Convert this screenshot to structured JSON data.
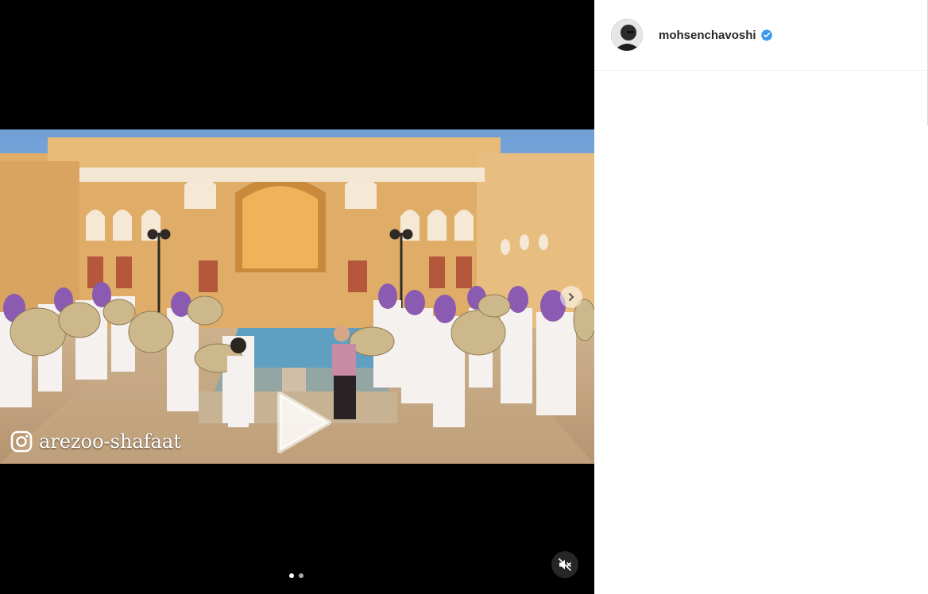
{
  "post": {
    "username": "mohsenchavoshi",
    "verified": true,
    "watermark_text": "arezoo-shafaat",
    "carousel": {
      "count": 2,
      "active": 0
    },
    "muted": true
  },
  "colors": {
    "media_bg": "#000000",
    "verified_blue": "#3897f0",
    "facade": "#e3b46b",
    "scarf_purple": "#8a5bb0",
    "sky": "#7fa9d8"
  },
  "icons": {
    "play": "play-icon",
    "next": "chevron-right-icon",
    "mute": "speaker-muted-icon",
    "watermark": "instagram-icon",
    "verified": "verified-badge-icon"
  }
}
